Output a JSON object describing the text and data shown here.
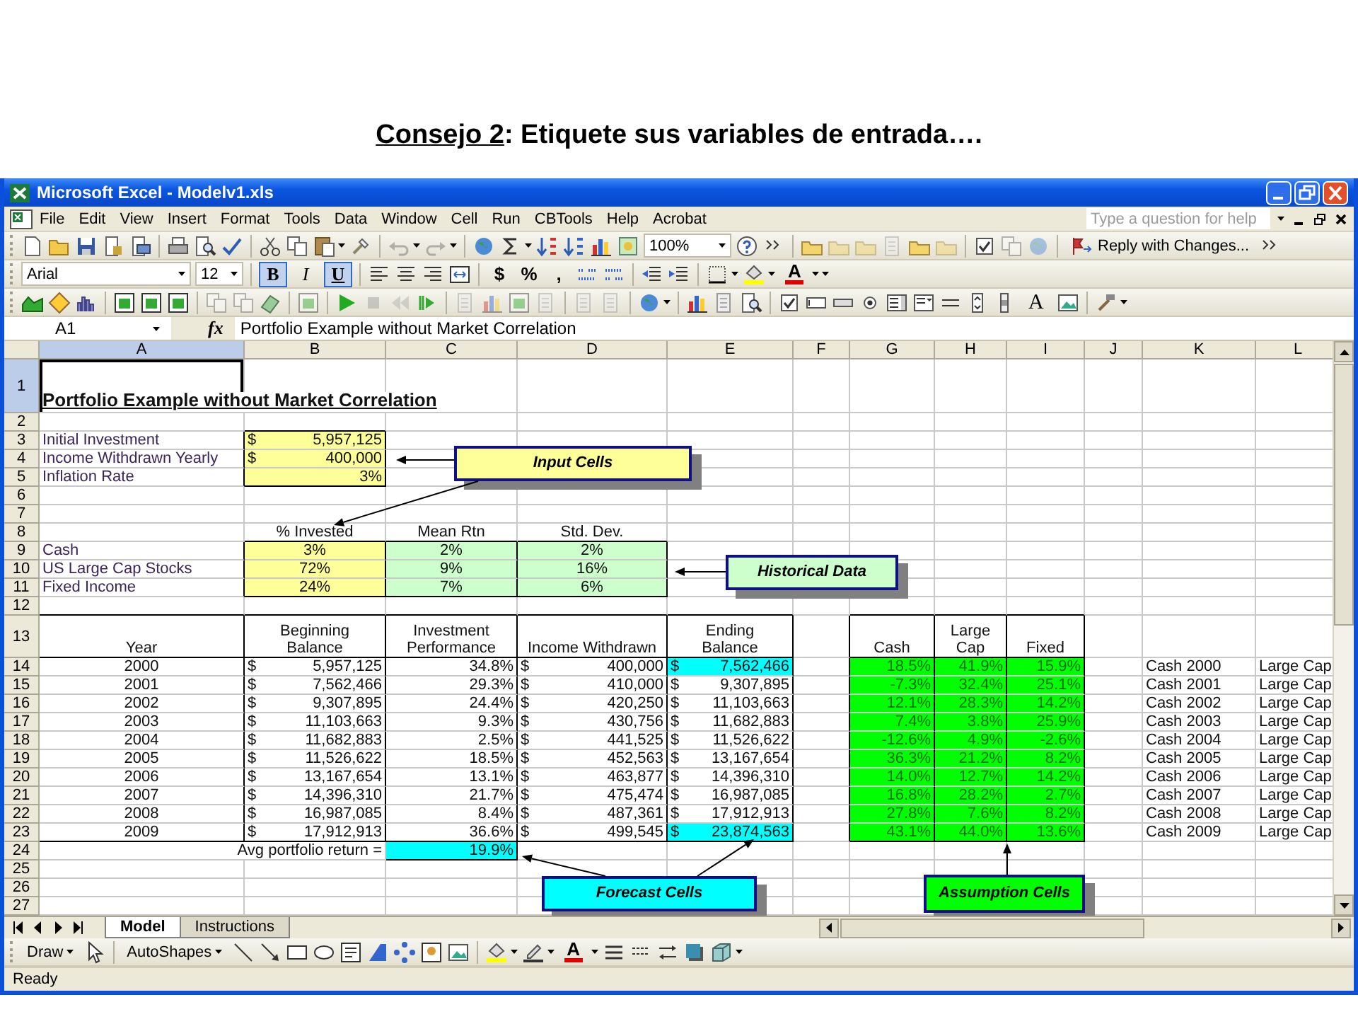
{
  "slide_title": {
    "label": "Consejo 2",
    "text": ": Etiquete sus variables de entrada…."
  },
  "window": {
    "title": "Microsoft Excel - Modelv1.xls"
  },
  "menu": [
    "File",
    "Edit",
    "View",
    "Insert",
    "Format",
    "Tools",
    "Data",
    "Window",
    "Cell",
    "Run",
    "CBTools",
    "Help",
    "Acrobat"
  ],
  "help_box": {
    "placeholder": "Type a question for help"
  },
  "standard_toolbar": {
    "zoom": "100%",
    "reply_button": "Reply with Changes..."
  },
  "formatting_toolbar": {
    "font": "Arial",
    "size": "12",
    "styles": [
      {
        "label": "B",
        "pressed": true
      },
      {
        "label": "I",
        "pressed": false
      },
      {
        "label": "U",
        "pressed": true
      }
    ],
    "number_formats": [
      "$",
      "%",
      ","
    ],
    "font_color_label": "A"
  },
  "forms_toolbar": {
    "label_tool": "A"
  },
  "formula_bar": {
    "name_box": "A1",
    "function_label": "fx",
    "formula": "Portfolio Example without Market Correlation"
  },
  "sheet": {
    "columns": [
      {
        "label": "A",
        "selected": true
      },
      {
        "label": "B",
        "selected": false
      },
      {
        "label": "C",
        "selected": false
      },
      {
        "label": "D",
        "selected": false
      },
      {
        "label": "E",
        "selected": false
      },
      {
        "label": "F",
        "selected": false
      },
      {
        "label": "G",
        "selected": false
      },
      {
        "label": "H",
        "selected": false
      },
      {
        "label": "I",
        "selected": false
      },
      {
        "label": "J",
        "selected": false
      },
      {
        "label": "K",
        "selected": false
      },
      {
        "label": "L",
        "selected": false
      }
    ],
    "row_numbers": [
      {
        "label": "1",
        "selected": true
      },
      {
        "label": "2",
        "selected": false
      },
      {
        "label": "3",
        "selected": false
      },
      {
        "label": "4",
        "selected": false
      },
      {
        "label": "5",
        "selected": false
      },
      {
        "label": "6",
        "selected": false
      },
      {
        "label": "7",
        "selected": false
      },
      {
        "label": "8",
        "selected": false
      },
      {
        "label": "9",
        "selected": false
      },
      {
        "label": "10",
        "selected": false
      },
      {
        "label": "11",
        "selected": false
      },
      {
        "label": "12",
        "selected": false
      },
      {
        "label": "13",
        "selected": false
      },
      {
        "label": "14",
        "selected": false
      },
      {
        "label": "15",
        "selected": false
      },
      {
        "label": "16",
        "selected": false
      },
      {
        "label": "17",
        "selected": false
      },
      {
        "label": "18",
        "selected": false
      },
      {
        "label": "19",
        "selected": false
      },
      {
        "label": "20",
        "selected": false
      },
      {
        "label": "21",
        "selected": false
      },
      {
        "label": "22",
        "selected": false
      },
      {
        "label": "23",
        "selected": false
      },
      {
        "label": "24",
        "selected": false
      },
      {
        "label": "25",
        "selected": false
      },
      {
        "label": "26",
        "selected": false
      },
      {
        "label": "27",
        "selected": false
      }
    ],
    "title": "Portfolio Example without Market Correlation",
    "inputs": [
      {
        "label": "Initial Investment",
        "currency": "$",
        "value": "5,957,125"
      },
      {
        "label": "Income Withdrawn Yearly",
        "currency": "$",
        "value": "400,000"
      },
      {
        "label": "Inflation Rate",
        "value": "3%"
      }
    ],
    "allocation_headers": [
      "% Invested",
      "Mean Rtn",
      "Std. Dev."
    ],
    "assets": [
      {
        "name": "Cash",
        "invested": "3%",
        "mean_return": "2%",
        "std_dev": "2%"
      },
      {
        "name": "US Large Cap Stocks",
        "invested": "72%",
        "mean_return": "9%",
        "std_dev": "16%"
      },
      {
        "name": "Fixed Income",
        "invested": "24%",
        "mean_return": "7%",
        "std_dev": "6%"
      }
    ],
    "projection_headers": [
      "Year",
      "Beginning Balance",
      "Investment Performance",
      "Income Withdrawn",
      "Ending Balance"
    ],
    "assumption_headers": [
      "Cash",
      "Large Cap",
      "Fixed"
    ],
    "years": [
      {
        "year": "2000",
        "beginning_balance": {
          "currency": "$",
          "value": "5,957,125"
        },
        "performance": "34.8%",
        "income_withdrawn": {
          "currency": "$",
          "value": "400,000"
        },
        "ending_balance": {
          "currency": "$",
          "value": "7,562,466",
          "highlighted": true
        },
        "cash": "18.5%",
        "large_cap": "41.9%",
        "fixed": "15.9%",
        "column_k": "Cash 2000",
        "column_l": "Large Cap"
      },
      {
        "year": "2001",
        "beginning_balance": {
          "currency": "$",
          "value": "7,562,466"
        },
        "performance": "29.3%",
        "income_withdrawn": {
          "currency": "$",
          "value": "410,000"
        },
        "ending_balance": {
          "currency": "$",
          "value": "9,307,895",
          "highlighted": false
        },
        "cash": "-7.3%",
        "large_cap": "32.4%",
        "fixed": "25.1%",
        "column_k": "Cash 2001",
        "column_l": "Large Cap"
      },
      {
        "year": "2002",
        "beginning_balance": {
          "currency": "$",
          "value": "9,307,895"
        },
        "performance": "24.4%",
        "income_withdrawn": {
          "currency": "$",
          "value": "420,250"
        },
        "ending_balance": {
          "currency": "$",
          "value": "11,103,663",
          "highlighted": false
        },
        "cash": "12.1%",
        "large_cap": "28.3%",
        "fixed": "14.2%",
        "column_k": "Cash 2002",
        "column_l": "Large Cap"
      },
      {
        "year": "2003",
        "beginning_balance": {
          "currency": "$",
          "value": "11,103,663"
        },
        "performance": "9.3%",
        "income_withdrawn": {
          "currency": "$",
          "value": "430,756"
        },
        "ending_balance": {
          "currency": "$",
          "value": "11,682,883",
          "highlighted": false
        },
        "cash": "7.4%",
        "large_cap": "3.8%",
        "fixed": "25.9%",
        "column_k": "Cash 2003",
        "column_l": "Large Cap"
      },
      {
        "year": "2004",
        "beginning_balance": {
          "currency": "$",
          "value": "11,682,883"
        },
        "performance": "2.5%",
        "income_withdrawn": {
          "currency": "$",
          "value": "441,525"
        },
        "ending_balance": {
          "currency": "$",
          "value": "11,526,622",
          "highlighted": false
        },
        "cash": "-12.6%",
        "large_cap": "4.9%",
        "fixed": "-2.6%",
        "column_k": "Cash 2004",
        "column_l": "Large Cap"
      },
      {
        "year": "2005",
        "beginning_balance": {
          "currency": "$",
          "value": "11,526,622"
        },
        "performance": "18.5%",
        "income_withdrawn": {
          "currency": "$",
          "value": "452,563"
        },
        "ending_balance": {
          "currency": "$",
          "value": "13,167,654",
          "highlighted": false
        },
        "cash": "36.3%",
        "large_cap": "21.2%",
        "fixed": "8.2%",
        "column_k": "Cash 2005",
        "column_l": "Large Cap"
      },
      {
        "year": "2006",
        "beginning_balance": {
          "currency": "$",
          "value": "13,167,654"
        },
        "performance": "13.1%",
        "income_withdrawn": {
          "currency": "$",
          "value": "463,877"
        },
        "ending_balance": {
          "currency": "$",
          "value": "14,396,310",
          "highlighted": false
        },
        "cash": "14.0%",
        "large_cap": "12.7%",
        "fixed": "14.2%",
        "column_k": "Cash 2006",
        "column_l": "Large Cap"
      },
      {
        "year": "2007",
        "beginning_balance": {
          "currency": "$",
          "value": "14,396,310"
        },
        "performance": "21.7%",
        "income_withdrawn": {
          "currency": "$",
          "value": "475,474"
        },
        "ending_balance": {
          "currency": "$",
          "value": "16,987,085",
          "highlighted": false
        },
        "cash": "16.8%",
        "large_cap": "28.2%",
        "fixed": "2.7%",
        "column_k": "Cash 2007",
        "column_l": "Large Cap"
      },
      {
        "year": "2008",
        "beginning_balance": {
          "currency": "$",
          "value": "16,987,085"
        },
        "performance": "8.4%",
        "income_withdrawn": {
          "currency": "$",
          "value": "487,361"
        },
        "ending_balance": {
          "currency": "$",
          "value": "17,912,913",
          "highlighted": false
        },
        "cash": "27.8%",
        "large_cap": "7.6%",
        "fixed": "8.2%",
        "column_k": "Cash 2008",
        "column_l": "Large Cap"
      },
      {
        "year": "2009",
        "beginning_balance": {
          "currency": "$",
          "value": "17,912,913"
        },
        "performance": "36.6%",
        "income_withdrawn": {
          "currency": "$",
          "value": "499,545"
        },
        "ending_balance": {
          "currency": "$",
          "value": "23,874,563",
          "highlighted": true
        },
        "cash": "43.1%",
        "large_cap": "44.0%",
        "fixed": "13.6%",
        "column_k": "Cash 2009",
        "column_l": "Large Cap"
      }
    ],
    "average": {
      "label": "Avg portfolio return =",
      "value": "19.9%"
    },
    "callouts": [
      {
        "text": "Input Cells",
        "kind": "input"
      },
      {
        "text": "Historical Data",
        "kind": "historical"
      },
      {
        "text": "Forecast Cells",
        "kind": "forecast"
      },
      {
        "text": "Assumption Cells",
        "kind": "assumption"
      }
    ]
  },
  "sheet_tabs": [
    {
      "label": "Model",
      "selected": true
    },
    {
      "label": "Instructions",
      "selected": false
    }
  ],
  "draw_toolbar": {
    "draw_menu": "Draw",
    "autoshapes_menu": "AutoShapes",
    "font_color_label": "A"
  },
  "status_bar": {
    "text": "Ready"
  }
}
